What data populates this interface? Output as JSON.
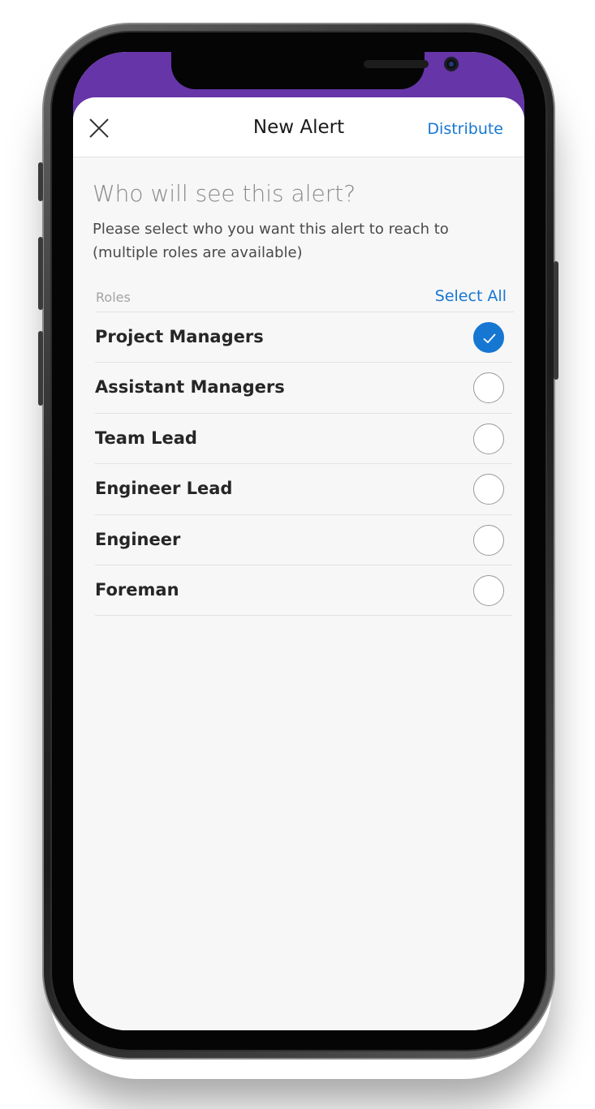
{
  "header": {
    "title": "New Alert",
    "close_icon": "close-icon",
    "distribute_label": "Distribute"
  },
  "intro": {
    "heading": "Who will see this alert?",
    "description": "Please select who you want this alert to reach to (multiple roles are available)"
  },
  "roles": {
    "label": "Roles",
    "select_all_label": "Select All",
    "items": [
      {
        "label": "Project Managers",
        "selected": true
      },
      {
        "label": "Assistant Managers",
        "selected": false
      },
      {
        "label": "Team Lead",
        "selected": false
      },
      {
        "label": "Engineer Lead",
        "selected": false
      },
      {
        "label": "Engineer",
        "selected": false
      },
      {
        "label": "Foreman",
        "selected": false
      }
    ]
  },
  "colors": {
    "accent": "#1677d2",
    "status_bar": "#6635a8",
    "background": "#f7f7f7"
  }
}
